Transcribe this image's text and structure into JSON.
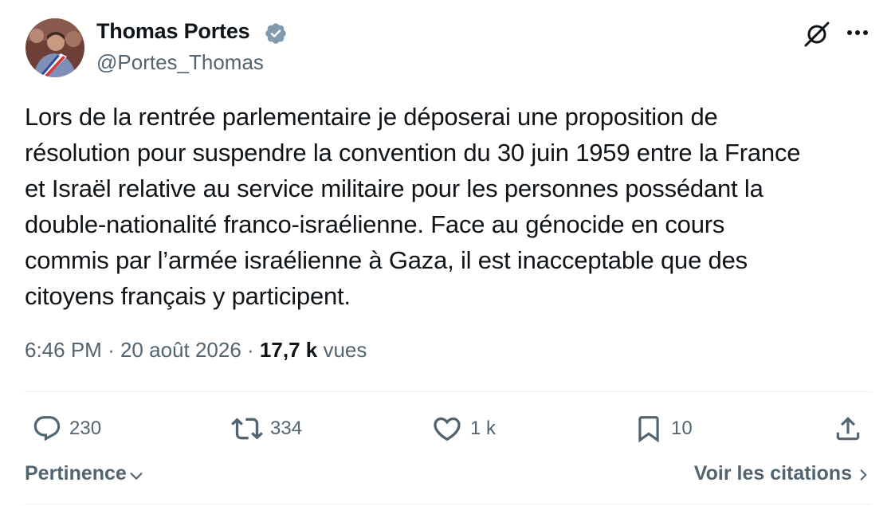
{
  "author": {
    "name": "Thomas Portes",
    "handle": "@Portes_Thomas",
    "verified": true
  },
  "tweet": {
    "text": "Lors de la rentrée parlementaire je déposerai une proposition de\nrésolution pour suspendre la convention du 30 juin 1959 entre la France\net Israël relative au service militaire pour les personnes possédant la\ndouble-nationalité franco-israélienne. Face au génocide en cours\ncommis par l’armée israélienne à Gaza, il est inacceptable que des\ncitoyens français y participent."
  },
  "meta": {
    "time": "6:46 PM",
    "separator": "·",
    "date": "20 août 2026",
    "views_count": "17,7 k",
    "views_label": "vues"
  },
  "actions": {
    "replies": "230",
    "reposts": "334",
    "likes": "1 k",
    "bookmarks": "10"
  },
  "footer": {
    "sort_label": "Pertinence",
    "quotes_label": "Voir les citations"
  },
  "colors": {
    "text_primary": "#0f1419",
    "text_secondary": "#536471",
    "divider": "#eff3f4",
    "verified_badge": "#829aab"
  },
  "icons": [
    "verified-badge-icon",
    "grok-icon",
    "more-icon",
    "reply-icon",
    "repost-icon",
    "like-icon",
    "bookmark-icon",
    "share-icon",
    "chevron-down-icon",
    "chevron-right-icon"
  ]
}
